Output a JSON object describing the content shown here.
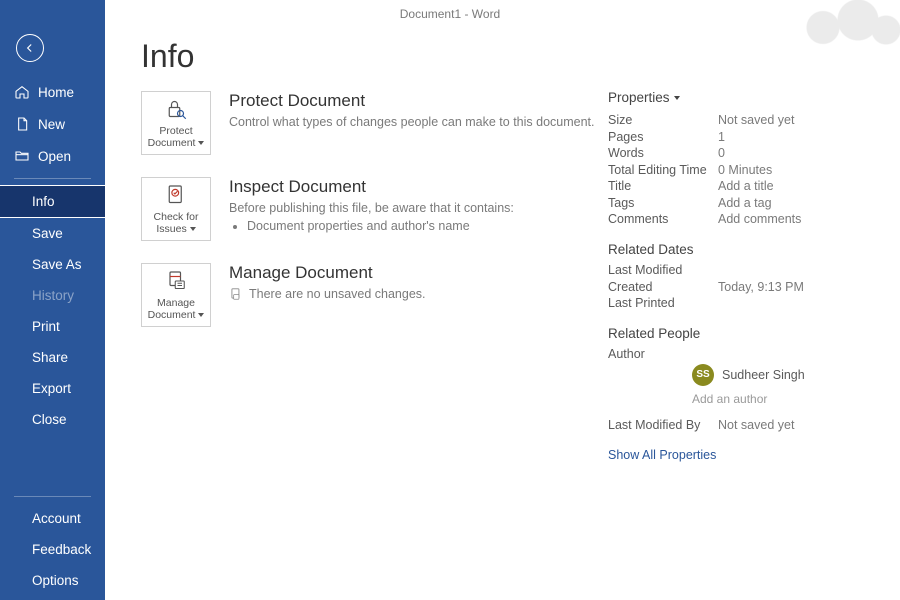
{
  "titlebar": "Document1  -  Word",
  "sidebar": {
    "top": [
      {
        "key": "home",
        "label": "Home",
        "icon": "home"
      },
      {
        "key": "new",
        "label": "New",
        "icon": "doc"
      },
      {
        "key": "open",
        "label": "Open",
        "icon": "folder"
      }
    ],
    "mid": [
      {
        "key": "info",
        "label": "Info",
        "selected": true
      },
      {
        "key": "save",
        "label": "Save"
      },
      {
        "key": "saveas",
        "label": "Save As"
      },
      {
        "key": "history",
        "label": "History",
        "disabled": true
      },
      {
        "key": "print",
        "label": "Print"
      },
      {
        "key": "share",
        "label": "Share"
      },
      {
        "key": "export",
        "label": "Export"
      },
      {
        "key": "close",
        "label": "Close"
      }
    ],
    "bottom": [
      {
        "key": "account",
        "label": "Account"
      },
      {
        "key": "feedback",
        "label": "Feedback"
      },
      {
        "key": "options",
        "label": "Options"
      }
    ]
  },
  "page": {
    "title": "Info",
    "blocks": {
      "protect": {
        "button": "Protect Document",
        "heading": "Protect Document",
        "desc": "Control what types of changes people can make to this document."
      },
      "inspect": {
        "button": "Check for Issues",
        "heading": "Inspect Document",
        "desc": "Before publishing this file, be aware that it contains:",
        "items": [
          "Document properties and author's name"
        ]
      },
      "manage": {
        "button": "Manage Document",
        "heading": "Manage Document",
        "desc": "There are no unsaved changes."
      }
    }
  },
  "properties": {
    "heading": "Properties",
    "rows": {
      "size": {
        "k": "Size",
        "v": "Not saved yet"
      },
      "pages": {
        "k": "Pages",
        "v": "1"
      },
      "words": {
        "k": "Words",
        "v": "0"
      },
      "tet": {
        "k": "Total Editing Time",
        "v": "0 Minutes"
      },
      "title": {
        "k": "Title",
        "v": "Add a title",
        "editable": true
      },
      "tags": {
        "k": "Tags",
        "v": "Add a tag",
        "editable": true
      },
      "comm": {
        "k": "Comments",
        "v": "Add comments",
        "editable": true
      }
    },
    "dates": {
      "heading": "Related Dates",
      "lastmod": {
        "k": "Last Modified",
        "v": ""
      },
      "created": {
        "k": "Created",
        "v": "Today, 9:13 PM"
      },
      "printed": {
        "k": "Last Printed",
        "v": ""
      }
    },
    "people": {
      "heading": "Related People",
      "author_label": "Author",
      "author_initials": "SS",
      "author_name": "Sudheer Singh",
      "add_author": "Add an author",
      "lastmodby": {
        "k": "Last Modified By",
        "v": "Not saved yet"
      }
    },
    "showall": "Show All Properties"
  }
}
